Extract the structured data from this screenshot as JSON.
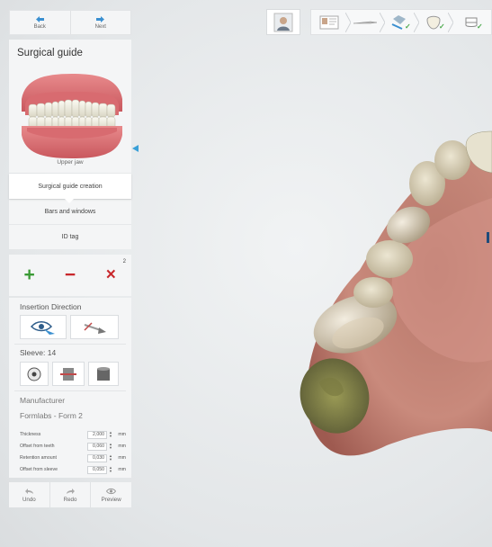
{
  "nav": {
    "back_label": "Back",
    "next_label": "Next"
  },
  "guide": {
    "title": "Surgical guide",
    "jaw_caption": "Upper jaw"
  },
  "steps": [
    {
      "label": "Surgical guide creation",
      "active": true
    },
    {
      "label": "Bars and windows",
      "active": false
    },
    {
      "label": "ID tag",
      "active": false
    }
  ],
  "actions": {
    "add": "+",
    "remove": "−",
    "delete": "×",
    "delete_count": "2"
  },
  "insertion": {
    "label": "Insertion Direction"
  },
  "sleeve": {
    "label": "Sleeve: 14"
  },
  "manufacturer": {
    "label": "Manufacturer",
    "value": "Formlabs - Form 2"
  },
  "fields": [
    {
      "label": "Thickness",
      "value": "2,000",
      "unit": "mm"
    },
    {
      "label": "Offset from teeth",
      "value": "0,060",
      "unit": "mm"
    },
    {
      "label": "Retention amount",
      "value": "0,030",
      "unit": "mm"
    },
    {
      "label": "Offset from sleeve",
      "value": "0,050",
      "unit": "mm"
    }
  ],
  "history": {
    "undo_label": "Undo",
    "redo_label": "Redo",
    "preview_label": "Preview"
  },
  "colors": {
    "accent": "#3aa0d8",
    "add": "#3a9a35",
    "remove": "#c8282c",
    "check": "#4aa84a"
  }
}
